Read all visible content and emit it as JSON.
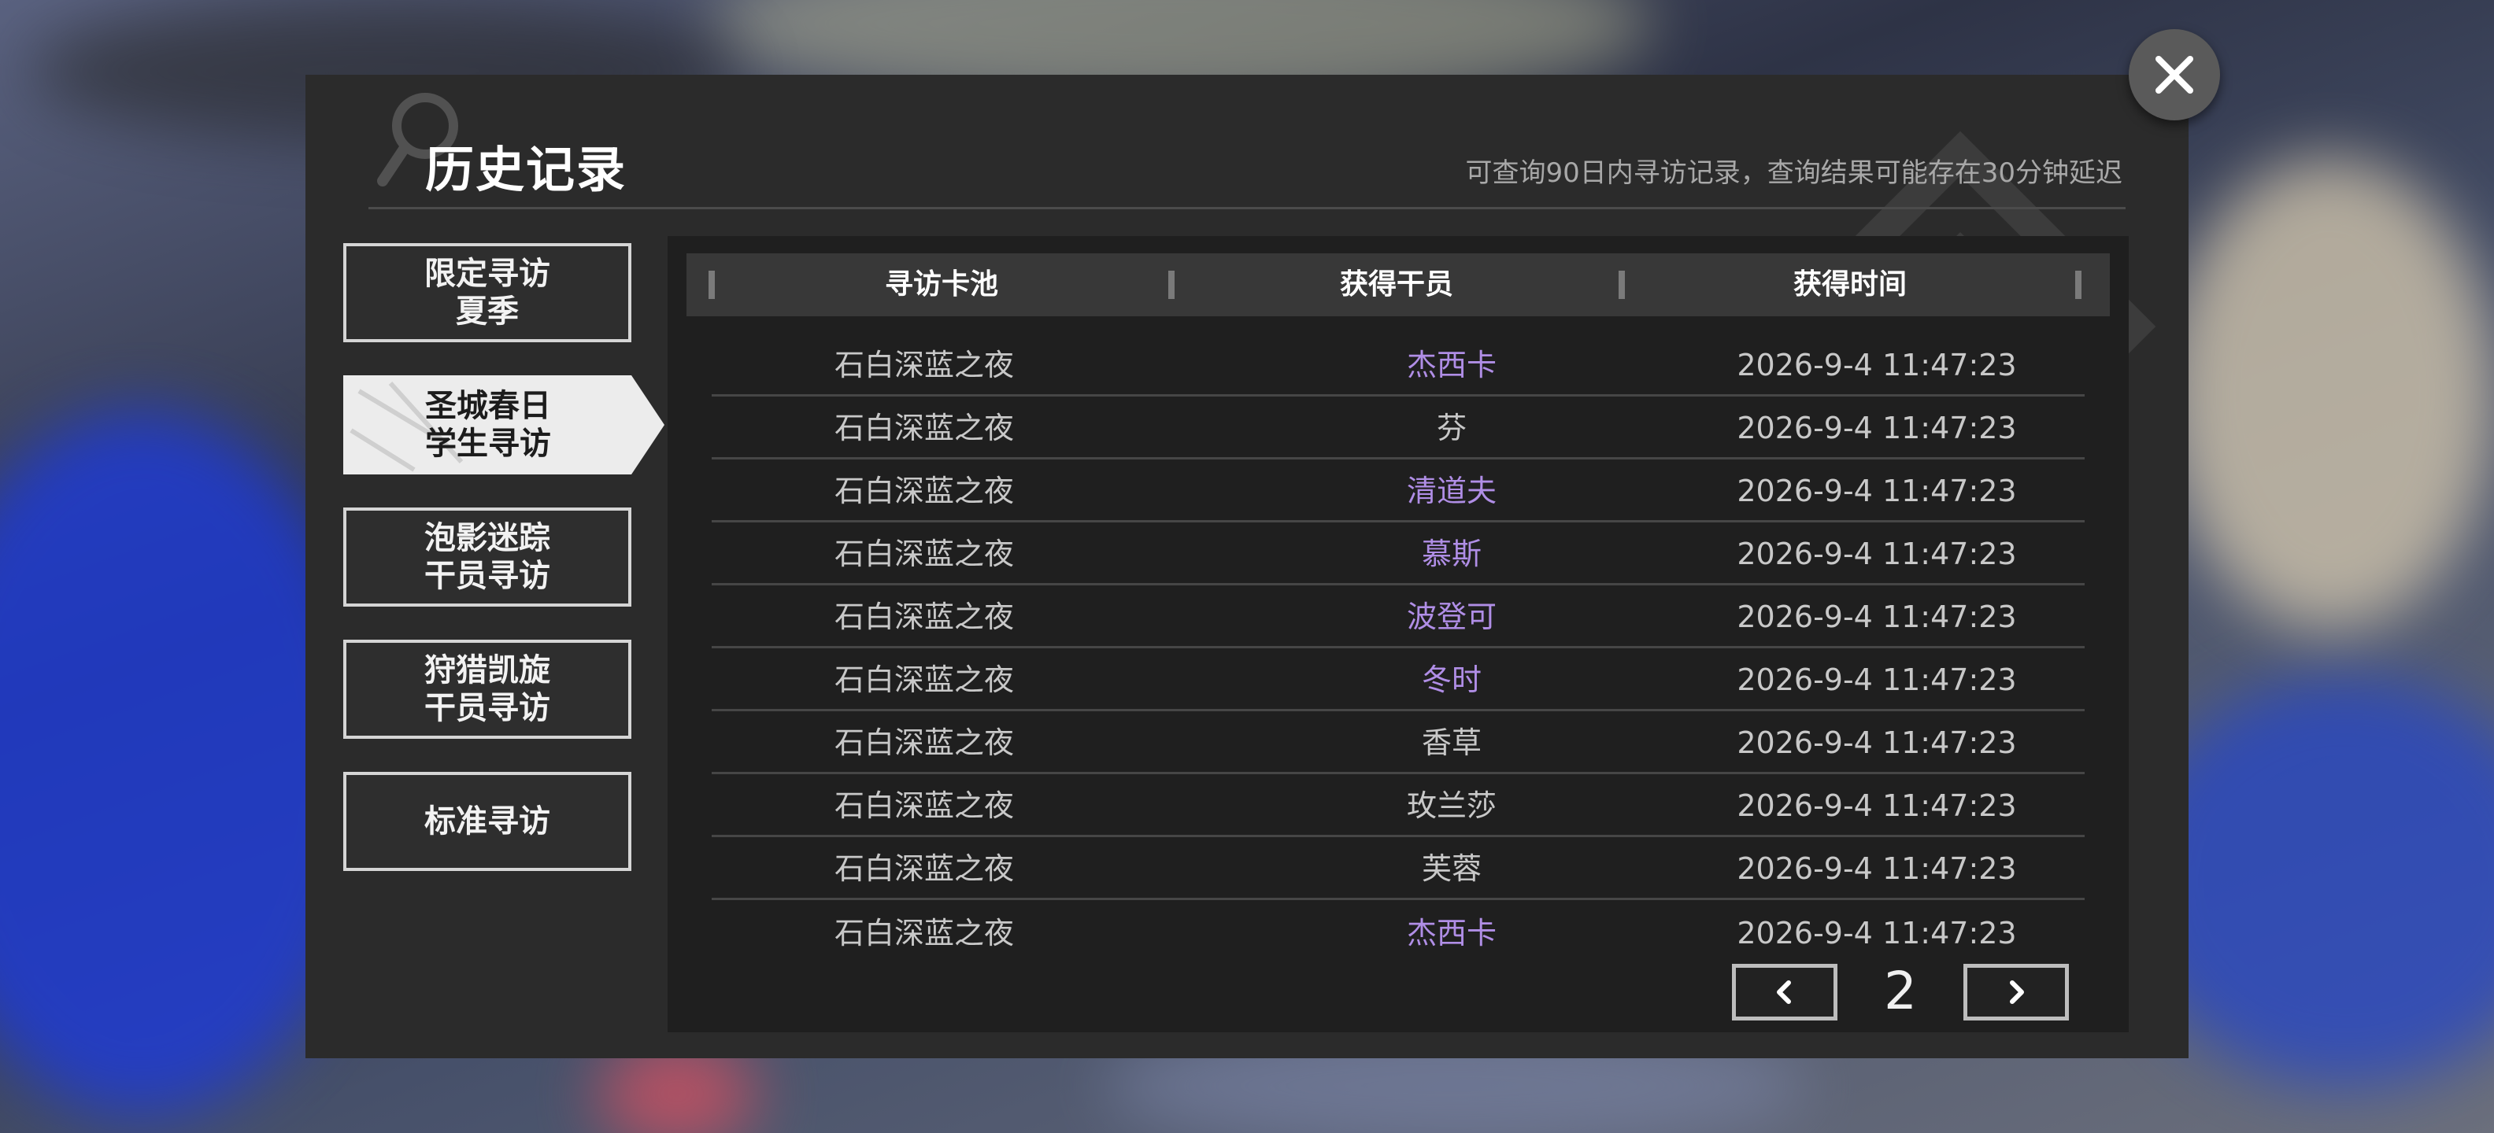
{
  "dialog": {
    "title": "历史记录",
    "note": "可查询90日内寻访记录，查询结果可能存在30分钟延迟"
  },
  "tabs": [
    {
      "label": "限定寻访\n夏季",
      "active": false
    },
    {
      "label": "圣城春日\n学生寻访",
      "active": true
    },
    {
      "label": "泡影迷踪\n干员寻访",
      "active": false
    },
    {
      "label": "狩猎凯旋\n干员寻访",
      "active": false
    },
    {
      "label": "标准寻访",
      "active": false
    }
  ],
  "table": {
    "headers": [
      "寻访卡池",
      "获得干员",
      "获得时间"
    ],
    "rows": [
      {
        "pool": "石白深蓝之夜",
        "operator": "杰西卡",
        "time": "2026-9-4 11:47:23",
        "highlight": true
      },
      {
        "pool": "石白深蓝之夜",
        "operator": "芬",
        "time": "2026-9-4 11:47:23",
        "highlight": false
      },
      {
        "pool": "石白深蓝之夜",
        "operator": "清道夫",
        "time": "2026-9-4 11:47:23",
        "highlight": true
      },
      {
        "pool": "石白深蓝之夜",
        "operator": "慕斯",
        "time": "2026-9-4 11:47:23",
        "highlight": true
      },
      {
        "pool": "石白深蓝之夜",
        "operator": "波登可",
        "time": "2026-9-4 11:47:23",
        "highlight": true
      },
      {
        "pool": "石白深蓝之夜",
        "operator": "冬时",
        "time": "2026-9-4 11:47:23",
        "highlight": true
      },
      {
        "pool": "石白深蓝之夜",
        "operator": "香草",
        "time": "2026-9-4 11:47:23",
        "highlight": false
      },
      {
        "pool": "石白深蓝之夜",
        "operator": "玫兰莎",
        "time": "2026-9-4 11:47:23",
        "highlight": false
      },
      {
        "pool": "石白深蓝之夜",
        "operator": "芙蓉",
        "time": "2026-9-4 11:47:23",
        "highlight": false
      },
      {
        "pool": "石白深蓝之夜",
        "operator": "杰西卡",
        "time": "2026-9-4 11:47:23",
        "highlight": true
      }
    ]
  },
  "pagination": {
    "current_page": "2"
  },
  "colors": {
    "highlight": "#b08ee6",
    "normal": "#c8c8c8"
  },
  "icons": {
    "close": "close-icon",
    "prev": "chevron-left-icon",
    "next": "chevron-right-icon"
  }
}
